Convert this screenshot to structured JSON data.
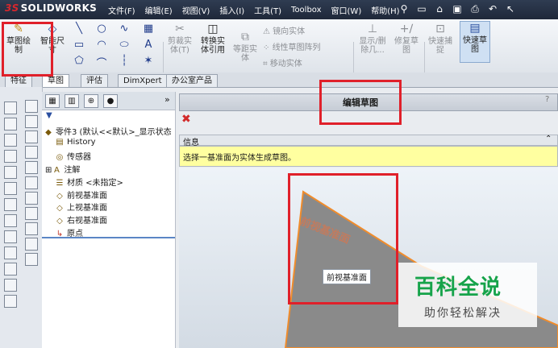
{
  "app": {
    "brand_prefix": "3S",
    "brand_name": "SOLIDWORKS"
  },
  "menus": [
    "文件(F)",
    "编辑(E)",
    "视图(V)",
    "插入(I)",
    "工具(T)",
    "Toolbox",
    "窗口(W)",
    "帮助(H)"
  ],
  "quick_access": [
    "pin-icon",
    "new-doc-icon",
    "open-icon",
    "save-icon",
    "print-icon",
    "undo-icon",
    "select-icon"
  ],
  "ribbon": {
    "sketch": "草图绘\n制",
    "smart_dimension": "智能尺\n寸",
    "trim": "剪裁实\n体(T)",
    "convert": "转换实\n体引用",
    "offset": "等距实\n体",
    "mirror": "镜向实体",
    "linear_pattern": "线性草图阵列",
    "move": "移动实体",
    "display_delete": "显示/删\n除几...",
    "repair": "修复草\n图",
    "quick_snap": "快速捕\n捉",
    "rapid_sketch": "快速草\n图"
  },
  "tabs": [
    "特征",
    "草图",
    "评估",
    "DimXpert",
    "办公室产品"
  ],
  "active_tab": "草图",
  "feature_tree": {
    "root": "零件3  (默认<<默认>_显示状态",
    "items": [
      "History",
      "传感器",
      "注解",
      "材质 <未指定>",
      "前视基准面",
      "上视基准面",
      "右视基准面",
      "原点"
    ]
  },
  "property_manager": {
    "title": "编辑草图",
    "help": "?",
    "info_title": "信息",
    "info_text": "选择一基准面为实体生成草图。"
  },
  "viewport": {
    "plane_tag": "前视基准面",
    "plane_label": "前视基准面",
    "plane_color": "#8a8a8a",
    "edge_color": "#f08c2c"
  },
  "watermark": {
    "line1": "百科全说",
    "line2": "助你轻松解决"
  },
  "colors": {
    "highlight_red": "#e0202a",
    "info_yellow": "#ffffa0",
    "watermark_green": "#16a34a"
  }
}
